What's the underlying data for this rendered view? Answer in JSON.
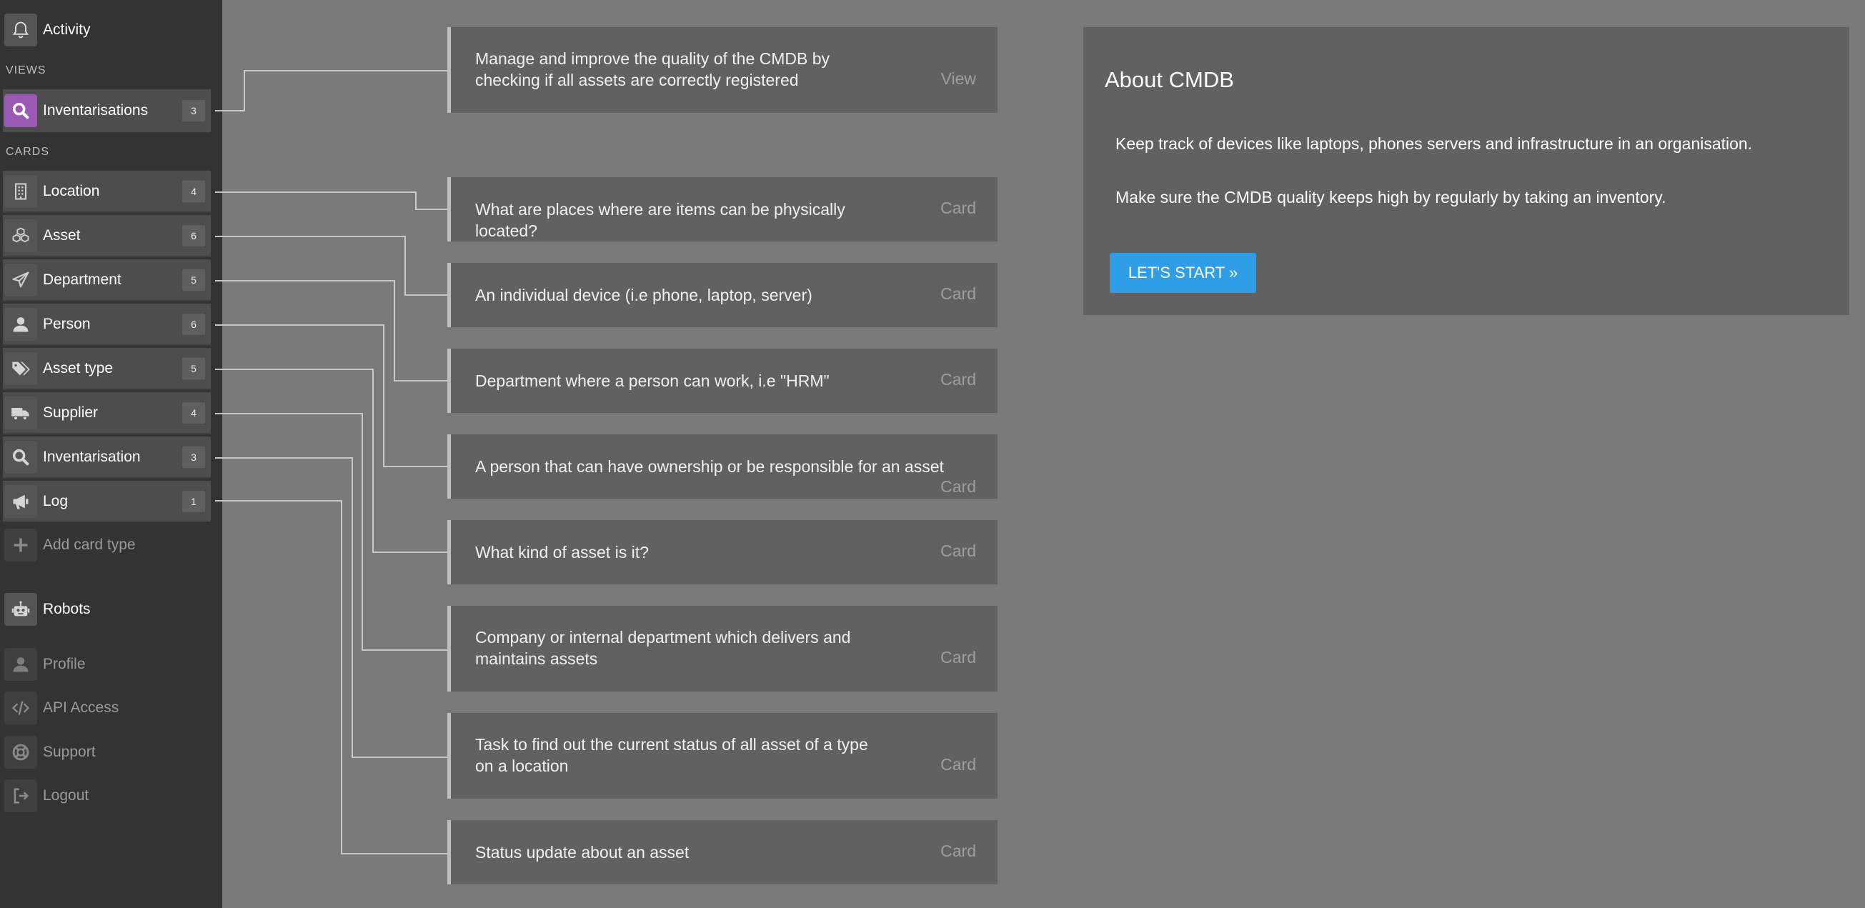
{
  "sidebar": {
    "activity": {
      "label": "Activity",
      "icon": "bell-icon"
    },
    "views_heading": "VIEWS",
    "views": [
      {
        "label": "Inventarisations",
        "count": "3",
        "icon": "search-icon",
        "accent": "#9b59b6"
      }
    ],
    "cards_heading": "CARDS",
    "cards": [
      {
        "label": "Location",
        "count": "4",
        "icon": "building-icon"
      },
      {
        "label": "Asset",
        "count": "6",
        "icon": "cubes-icon"
      },
      {
        "label": "Department",
        "count": "5",
        "icon": "paper-plane-icon"
      },
      {
        "label": "Person",
        "count": "6",
        "icon": "user-icon"
      },
      {
        "label": "Asset type",
        "count": "5",
        "icon": "tags-icon"
      },
      {
        "label": "Supplier",
        "count": "4",
        "icon": "truck-icon"
      },
      {
        "label": "Inventarisation",
        "count": "3",
        "icon": "search-icon"
      },
      {
        "label": "Log",
        "count": "1",
        "icon": "megaphone-icon"
      }
    ],
    "add_card_type": "Add card type",
    "robots": "Robots",
    "footer": [
      {
        "label": "Profile",
        "icon": "user-icon"
      },
      {
        "label": "API Access",
        "icon": "code-icon"
      },
      {
        "label": "Support",
        "icon": "lifebuoy-icon"
      },
      {
        "label": "Logout",
        "icon": "sign-out-icon"
      }
    ]
  },
  "descriptions": [
    {
      "text": "Manage and improve the quality of the CMDB by checking if all assets are correctly registered",
      "kind": "View"
    },
    {
      "text": "What are places where are items can be physically located?",
      "kind": "Card"
    },
    {
      "text": "An individual device (i.e phone, laptop, server)",
      "kind": "Card"
    },
    {
      "text": "Department where a person can work, i.e \"HRM\"",
      "kind": "Card"
    },
    {
      "text": "A person that can have ownership or be responsible for an asset",
      "kind": "Card"
    },
    {
      "text": "What kind of asset is it?",
      "kind": "Card"
    },
    {
      "text": "Company or internal department which delivers and maintains assets",
      "kind": "Card"
    },
    {
      "text": "Task to find out the current status of all asset of a type on a location",
      "kind": "Card"
    },
    {
      "text": "Status update about an asset",
      "kind": "Card"
    }
  ],
  "about": {
    "title": "About CMDB",
    "paragraph1": "Keep track of devices like laptops, phones servers and infrastructure in an organisation.",
    "paragraph2": "Make sure the CMDB quality keeps high by regularly by taking an inventory.",
    "button": "LET'S START »",
    "button_color": "#2f9ee6"
  }
}
